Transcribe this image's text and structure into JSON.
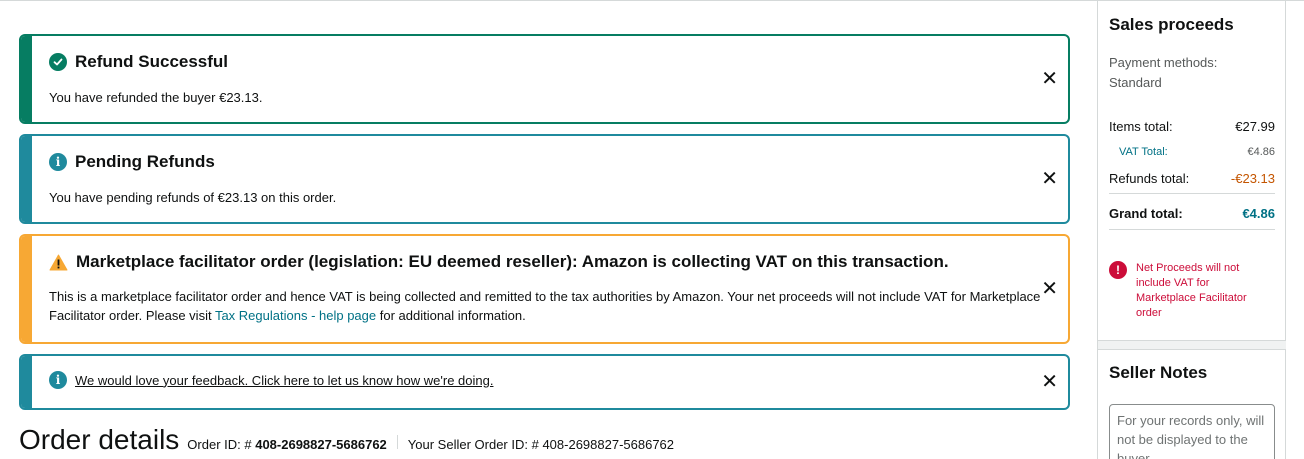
{
  "alerts": {
    "success": {
      "title": "Refund Successful",
      "message": "You have refunded the buyer €23.13.",
      "close": "✕"
    },
    "pending": {
      "title": "Pending Refunds",
      "message": "You have pending refunds of €23.13 on this order.",
      "close": "✕"
    },
    "marketplace": {
      "title": "Marketplace facilitator order (legislation: EU deemed reseller): Amazon is collecting VAT on this transaction.",
      "message_before": "This is a marketplace facilitator order and hence VAT is being collected and remitted to the tax authorities by Amazon. Your net proceeds will not include VAT for Marketplace Facilitator order. Please visit ",
      "link": "Tax Regulations - help page",
      "message_after": " for additional information.",
      "close": "✕"
    },
    "feedback": {
      "link": "We would love your feedback. Click here to let us know how we're doing.",
      "close": "✕"
    }
  },
  "order": {
    "heading": "Order details",
    "order_id_label": "Order ID: #",
    "order_id": "408-2698827-5686762",
    "seller_order_label": "Your Seller Order ID: #",
    "seller_order_id": "408-2698827-5686762"
  },
  "sidebar": {
    "sales_title": "Sales proceeds",
    "payment_methods": "Payment methods: Standard",
    "items_total_label": "Items total:",
    "items_total": "€27.99",
    "vat_total_label": "VAT Total:",
    "vat_total": "€4.86",
    "refunds_total_label": "Refunds total:",
    "refunds_total": "-€23.13",
    "grand_total_label": "Grand total:",
    "grand_total": "€4.86",
    "warning": "Net Proceeds will not include VAT for Marketplace Facilitator order",
    "notes_title": "Seller Notes",
    "notes_placeholder": "For your records only, will not be displayed to the buyer"
  },
  "icons": {
    "success": "check-circle-icon",
    "info": "info-circle-icon",
    "warning": "warning-triangle-icon",
    "error": "error-circle-icon",
    "close": "close-icon"
  },
  "colors": {
    "success": "#067d62",
    "info": "#1f8a9d",
    "warning": "#f7a834",
    "error": "#cc0c39",
    "link": "#007185",
    "negative": "#c45500"
  }
}
